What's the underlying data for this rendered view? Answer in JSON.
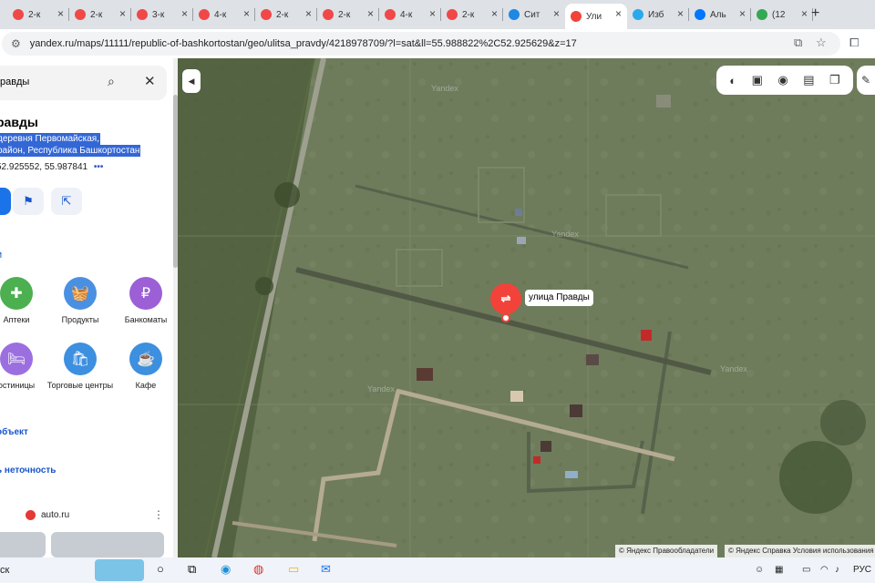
{
  "browser": {
    "tabs": [
      {
        "label": "2-к",
        "favicon": "avito-icon",
        "color": "#f04848"
      },
      {
        "label": "2-к",
        "favicon": "avito-icon",
        "color": "#f04848"
      },
      {
        "label": "3-к",
        "favicon": "avito-icon",
        "color": "#f04848"
      },
      {
        "label": "4-к",
        "favicon": "avito-icon",
        "color": "#f04848"
      },
      {
        "label": "2-к",
        "favicon": "avito-icon",
        "color": "#f04848"
      },
      {
        "label": "2-к",
        "favicon": "avito-icon",
        "color": "#f04848"
      },
      {
        "label": "4-к",
        "favicon": "avito-icon",
        "color": "#f04848"
      },
      {
        "label": "2-к",
        "favicon": "avito-icon",
        "color": "#f04848"
      },
      {
        "label": "Сит",
        "favicon": "sitimobil-icon",
        "color": "#1e88e5"
      },
      {
        "label": "Ули",
        "favicon": "yandex-maps-pin-icon",
        "color": "#f2433a"
      },
      {
        "label": "Изб",
        "favicon": "telegram-icon",
        "color": "#29a9eb"
      },
      {
        "label": "Аль",
        "favicon": "vk-icon",
        "color": "#0077ff"
      },
      {
        "label": "(12",
        "favicon": "google-maps-icon",
        "color": "#34a853"
      }
    ],
    "new_tab_glyph": "+",
    "url": "yandex.ru/maps/11111/republic-of-bashkortostan/geo/ulitsa_pravdy/4218978709/?l=sat&ll=55.988822%2C52.925629&z=17"
  },
  "panel": {
    "search_query": "равды",
    "title": "равды",
    "address_line1": "деревня Первомайская,",
    "address_line2": "район, Республика Башкортостан",
    "coords": "52.925552, 55.987841",
    "more": "•••",
    "section_glyph": "и",
    "categories": [
      {
        "label": "Аптеки",
        "icon": "plus-icon",
        "glyph": "✚",
        "color": "#4caf50"
      },
      {
        "label": "Продукты",
        "icon": "basket-icon",
        "glyph": "🧺",
        "color": "#4a90e2"
      },
      {
        "label": "Банкоматы",
        "icon": "ruble-icon",
        "glyph": "₽",
        "color": "#9c5fd6"
      },
      {
        "label": "остиницы",
        "icon": "bed-icon",
        "glyph": "🛏",
        "color": "#9c6fe0"
      },
      {
        "label": "Торговые центры",
        "icon": "shopping-bag-icon",
        "glyph": "🛍",
        "color": "#3d8fe0"
      },
      {
        "label": "Кафе",
        "icon": "coffee-cup-icon",
        "glyph": "☕",
        "color": "#3d8fe0"
      }
    ],
    "add_object": "объект",
    "report_error": "ь неточность",
    "ad_brand": "auto.ru",
    "ad_menu": "⋮"
  },
  "map": {
    "marker_label": "улица Правды",
    "watermarks": [
      "Yandex",
      "Yandex",
      "Yandex",
      "Yandex"
    ],
    "copyright_left": "© Яндекс  Правообладатели",
    "copyright_right": "© Яндекс  Справка  Условия использования"
  },
  "taskbar": {
    "search": "ск",
    "lang": "РУС"
  }
}
